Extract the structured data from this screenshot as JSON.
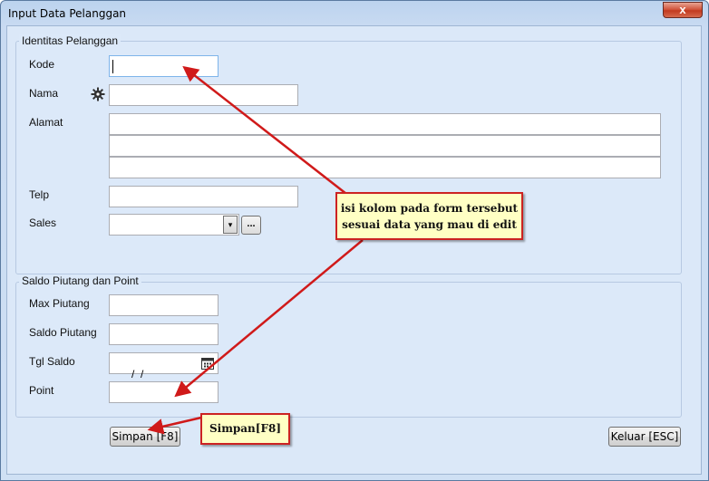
{
  "window": {
    "title": "Input Data Pelanggan",
    "close_glyph": "x"
  },
  "identitas": {
    "group_title": "Identitas Pelanggan",
    "kode_label": "Kode",
    "kode_value": "",
    "nama_label": "Nama",
    "nama_value": "",
    "alamat_label": "Alamat",
    "alamat_lines": [
      "",
      "",
      ""
    ],
    "telp_label": "Telp",
    "telp_value": "",
    "sales_label": "Sales",
    "sales_value": "",
    "sales_dropdown_glyph": "▾",
    "sales_browse_label": "..."
  },
  "saldo": {
    "group_title": "Saldo Piutang dan Point",
    "max_piutang_label": "Max Piutang",
    "max_piutang_value": "",
    "saldo_piutang_label": "Saldo Piutang",
    "saldo_piutang_value": "",
    "tgl_saldo_label": "Tgl Saldo",
    "tgl_saldo_value": "  /  /",
    "point_label": "Point",
    "point_value": ""
  },
  "buttons": {
    "simpan_label": "Simpan [F8]",
    "keluar_label": "Keluar [ESC]"
  },
  "annotations": {
    "callout_main_line1": "isi kolom pada form tersebut",
    "callout_main_line2": "sesuai data yang mau di edit",
    "callout_simpan": "Simpan[F8]"
  },
  "colors": {
    "arrow": "#d01a1a",
    "callout_border": "#cc2222",
    "callout_fill": "#ffffc4"
  },
  "icons": {
    "nama_lookup": "gear-icon",
    "tgl_picker": "calendar-icon"
  }
}
